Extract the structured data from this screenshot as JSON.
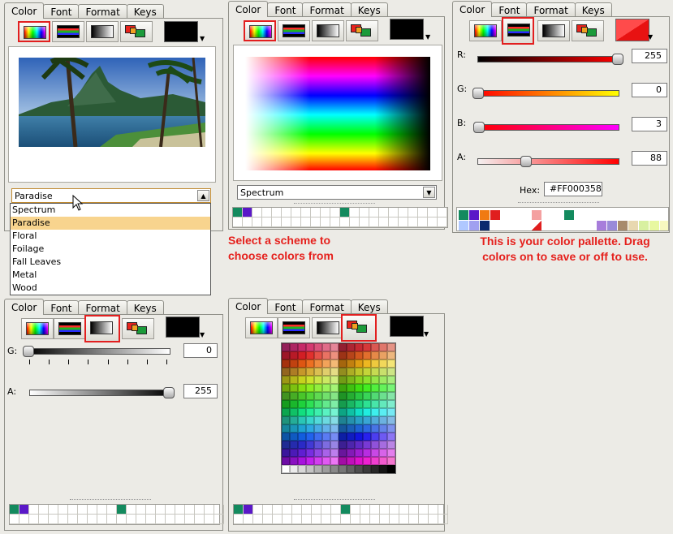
{
  "tabs": [
    "Color",
    "Font",
    "Format",
    "Keys"
  ],
  "image_panel": {
    "scheme_selected": "Paradise",
    "schemes": [
      "Spectrum",
      "Paradise",
      "Floral",
      "Foilage",
      "Fall Leaves",
      "Metal",
      "Wood"
    ],
    "selected_index": 1
  },
  "spectrum_panel": {
    "scheme_selected": "Spectrum"
  },
  "caption_left": [
    "Select a scheme to",
    "choose colors from"
  ],
  "caption_right": [
    "This is your color pallette. Drag",
    "colors on to save or off to use."
  ],
  "rgb_panel": {
    "sliders": [
      {
        "label": "R:",
        "value": "255",
        "fraction": 1.0
      },
      {
        "label": "G:",
        "value": "0",
        "fraction": 0.0
      },
      {
        "label": "B:",
        "value": "3",
        "fraction": 0.01
      },
      {
        "label": "A:",
        "value": "88",
        "fraction": 0.35
      }
    ],
    "hex_label": "Hex:",
    "hex_value": "#FF000358",
    "preview_color": "#ff3a3a"
  },
  "gray_panel": {
    "sliders": [
      {
        "label": "G:",
        "value": "0",
        "fraction": 0.0
      },
      {
        "label": "A:",
        "value": "255",
        "fraction": 1.0
      }
    ]
  },
  "palette": {
    "saved_a": [
      "#138a5e",
      "#5a18c8",
      "",
      "",
      "",
      "",
      "",
      "",
      "",
      "",
      "",
      "#138a5e"
    ],
    "colors_rgb": [
      "#138a5e",
      "#5a18c8",
      "#f07a12",
      "#e01e1e",
      "",
      "",
      "",
      "#f4a0a0",
      "",
      "",
      "",
      "#138a5e",
      "",
      ""
    ]
  },
  "icons": {
    "spectrum": "spectrum-icon",
    "rgb": "rgb-sliders-icon",
    "gray": "grayscale-icon",
    "swatches": "swatches-icon"
  }
}
